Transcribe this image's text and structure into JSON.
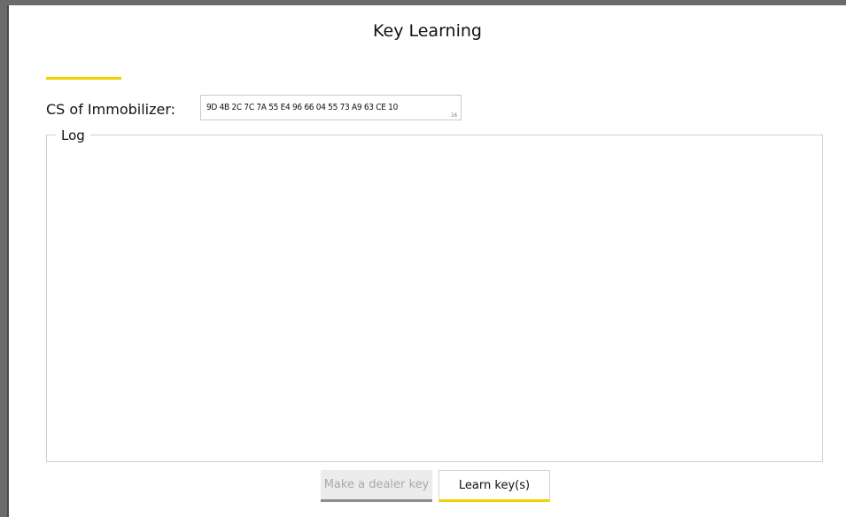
{
  "window": {
    "title": "Key Learning"
  },
  "immobilizer": {
    "label": "CS of Immobilizer:",
    "value": "9D 4B 2C 7C 7A 55 E4 96 66 04 55 73 A9 63 CE 10",
    "base_indicator": "16"
  },
  "log": {
    "legend": "Log",
    "content": ""
  },
  "buttons": {
    "make_dealer_key": "Make a dealer key",
    "learn_keys": "Learn key(s)"
  },
  "colors": {
    "accent": "#f5d000",
    "disabled_text": "#a9a9a9",
    "disabled_bg": "#ececec"
  }
}
